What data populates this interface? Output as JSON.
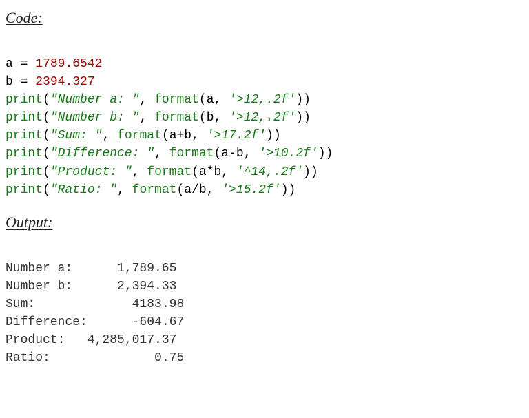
{
  "headings": {
    "code": "Code:",
    "output": "Output:"
  },
  "code": {
    "l1": {
      "v1": "a",
      "op": "=",
      "n": "1789.6542"
    },
    "l2": {
      "v1": "b",
      "op": "=",
      "n": "2394.327"
    },
    "l3": {
      "fn": "print",
      "lp": "(",
      "s1": "\"Number a: \"",
      "c": ", ",
      "fn2": "format",
      "lp2": "(",
      "arg": "a",
      "c2": ", ",
      "s2": "'>12,.2f'",
      "rp2": ")",
      "rp": ")"
    },
    "l4": {
      "fn": "print",
      "lp": "(",
      "s1": "\"Number b: \"",
      "c": ", ",
      "fn2": "format",
      "lp2": "(",
      "arg": "b",
      "c2": ", ",
      "s2": "'>12,.2f'",
      "rp2": ")",
      "rp": ")"
    },
    "l5": {
      "fn": "print",
      "lp": "(",
      "s1": "\"Sum: \"",
      "c": ", ",
      "fn2": "format",
      "lp2": "(",
      "arg": "a+b",
      "c2": ", ",
      "s2": "'>17.2f'",
      "rp2": ")",
      "rp": ")"
    },
    "l6": {
      "fn": "print",
      "lp": "(",
      "s1": "\"Difference: \"",
      "c": ", ",
      "fn2": "format",
      "lp2": "(",
      "arg": "a-b",
      "c2": ", ",
      "s2": "'>10.2f'",
      "rp2": ")",
      "rp": ")"
    },
    "l7": {
      "fn": "print",
      "lp": "(",
      "s1": "\"Product: \"",
      "c": ", ",
      "fn2": "format",
      "lp2": "(",
      "arg": "a*b",
      "c2": ", ",
      "s2": "'^14,.2f'",
      "rp2": ")",
      "rp": ")"
    },
    "l8": {
      "fn": "print",
      "lp": "(",
      "s1": "\"Ratio: \"",
      "c": ", ",
      "fn2": "format",
      "lp2": "(",
      "arg": "a/b",
      "c2": ", ",
      "s2": "'>15.2f'",
      "rp2": ")",
      "rp": ")"
    }
  },
  "output": {
    "l1": "Number a:      1,789.65",
    "l2": "Number b:      2,394.33",
    "l3": "Sum:             4183.98",
    "l4": "Difference:      -604.67",
    "l5": "Product:   4,285,017.37 ",
    "l6": "Ratio:              0.75"
  }
}
